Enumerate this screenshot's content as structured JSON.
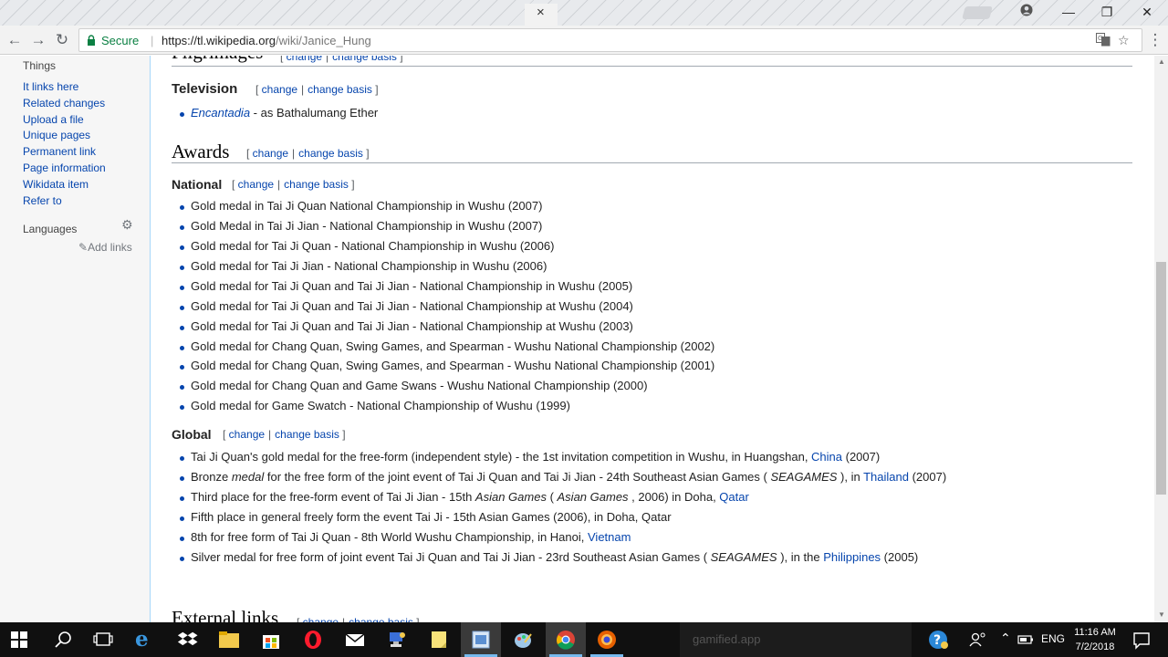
{
  "browser": {
    "tab_close": "×",
    "window_controls": {
      "minimize": "—",
      "restore": "❐",
      "close": "✕"
    },
    "secure_label": "Secure",
    "url_host": "https://tl.wikipedia.org",
    "url_path": "/wiki/Janice_Hung"
  },
  "sidebar": {
    "tools_heading": "Things",
    "tools": [
      "It links here",
      "Related changes",
      "Upload a file",
      "Unique pages",
      "Permanent link",
      "Page information",
      "Wikidata item",
      "Refer to"
    ],
    "languages_heading": "Languages",
    "add_links": "Add links"
  },
  "edit_links": {
    "change": "change",
    "change_source": "change basis"
  },
  "article": {
    "prev_heading": "Pilgrimages",
    "television": {
      "heading": "Television",
      "items": [
        {
          "link": "Encantadia",
          "rest": " - as Bathalumang Ether"
        }
      ]
    },
    "awards": {
      "heading": "Awards",
      "national": {
        "heading": "National",
        "items": [
          "Gold medal in Tai Ji Quan National Championship in Wushu (2007)",
          "Gold Medal in Tai Ji Jian - National Championship in Wushu (2007)",
          "Gold medal for Tai Ji Quan - National Championship in Wushu (2006)",
          "Gold medal for Tai Ji Jian - National Championship in Wushu (2006)",
          "Gold medal for Tai Ji Quan and Tai Ji Jian - National Championship in Wushu (2005)",
          "Gold medal for Tai Ji Quan and Tai Ji Jian - National Championship at Wushu (2004)",
          "Gold medal for Tai Ji Quan and Tai Ji Jian - National Championship at Wushu (2003)",
          "Gold medal for Chang Quan, Swing Games, and Spearman - Wushu National Championship (2002)",
          "Gold medal for Chang Quan, Swing Games, and Spearman - Wushu National Championship (2001)",
          "Gold medal for Chang Quan and Game Swans - Wushu National Championship (2000)",
          "Gold medal for Game Swatch - National Championship of Wushu (1999)"
        ]
      },
      "global": {
        "heading": "Global",
        "items": [
          {
            "a": "Tai Ji Quan's gold medal for the free-form (independent style) - the 1st invitation competition in Wushu, in Huangshan, ",
            "link": "China",
            "b": " (2007)"
          },
          {
            "a": "Bronze ",
            "i1": "medal",
            "b": " for the free form of the joint event of Tai Ji Quan and Tai Ji Jian - 24th Southeast Asian Games ( ",
            "i2": "SEAGAMES",
            "c": " ), in ",
            "link": "Thailand",
            "d": " (2007)"
          },
          {
            "a": "Third place for the free-form event of Tai Ji Jian - 15th ",
            "i1": "Asian Games",
            "b": " ( ",
            "i2": "Asian Games",
            "c": " , 2006) in Doha, ",
            "link": "Qatar"
          },
          {
            "a": "Fifth place in general freely form the event Tai Ji - 15th Asian Games (2006), in Doha, Qatar"
          },
          {
            "a": "8th for free form of Tai Ji Quan - 8th World Wushu Championship, in Hanoi, ",
            "link": "Vietnam"
          },
          {
            "a": "Silver medal for free form of joint event Tai Ji Quan and Tai Ji Jian - 23rd Southeast Asian Games ( ",
            "i1": "SEAGAMES",
            "b": " ), in the ",
            "link": "Philippines",
            "c": " (2005)"
          }
        ]
      }
    },
    "next_heading": "External links"
  },
  "taskbar": {
    "search_text": "gamified.app",
    "language": "ENG",
    "time": "11:16 AM",
    "date": "7/2/2018",
    "accent": "#76b9ed"
  }
}
